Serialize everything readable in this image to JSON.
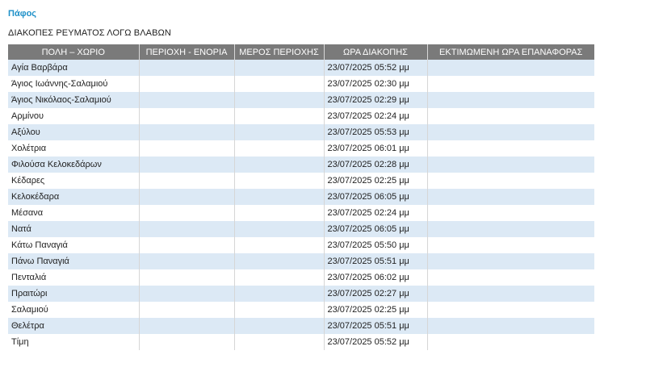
{
  "region": "Πάφος",
  "heading": "ΔΙΑΚΟΠΕΣ ΡΕΥΜΑΤΟΣ ΛΟΓΩ ΒΛΑΒΩΝ",
  "columns": [
    "ΠΟΛΗ – ΧΩΡΙΟ",
    "ΠΕΡΙΟΧΗ - ΕΝΟΡΙΑ",
    "ΜΕΡΟΣ ΠΕΡΙΟΧΗΣ",
    "ΩΡΑ ΔΙΑΚΟΠΗΣ",
    "ΕΚΤΙΜΩΜΕΝΗ ΩΡΑ ΕΠΑΝΑΦΟΡΑΣ"
  ],
  "rows": [
    {
      "village": "Αγία Βαρβάρα",
      "area": "",
      "part": "",
      "outage_time": "23/07/2025 05:52 μμ",
      "restore_time": ""
    },
    {
      "village": "Άγιος Ιωάννης-Σαλαμιού",
      "area": "",
      "part": "",
      "outage_time": "23/07/2025 02:30 μμ",
      "restore_time": ""
    },
    {
      "village": "Άγιος Νικόλαος-Σαλαμιού",
      "area": "",
      "part": "",
      "outage_time": "23/07/2025 02:29 μμ",
      "restore_time": ""
    },
    {
      "village": "Αρμίνου",
      "area": "",
      "part": "",
      "outage_time": "23/07/2025 02:24 μμ",
      "restore_time": ""
    },
    {
      "village": "Αξύλου",
      "area": "",
      "part": "",
      "outage_time": "23/07/2025 05:53 μμ",
      "restore_time": ""
    },
    {
      "village": "Χολέτρια",
      "area": "",
      "part": "",
      "outage_time": "23/07/2025 06:01 μμ",
      "restore_time": ""
    },
    {
      "village": "Φιλούσα Κελοκεδάρων",
      "area": "",
      "part": "",
      "outage_time": "23/07/2025 02:28 μμ",
      "restore_time": ""
    },
    {
      "village": "Κέδαρες",
      "area": "",
      "part": "",
      "outage_time": "23/07/2025 02:25 μμ",
      "restore_time": ""
    },
    {
      "village": "Κελοκέδαρα",
      "area": "",
      "part": "",
      "outage_time": "23/07/2025 06:05 μμ",
      "restore_time": ""
    },
    {
      "village": "Μέσανα",
      "area": "",
      "part": "",
      "outage_time": "23/07/2025 02:24 μμ",
      "restore_time": ""
    },
    {
      "village": "Νατά",
      "area": "",
      "part": "",
      "outage_time": "23/07/2025 06:05 μμ",
      "restore_time": ""
    },
    {
      "village": "Κάτω Παναγιά",
      "area": "",
      "part": "",
      "outage_time": "23/07/2025 05:50 μμ",
      "restore_time": ""
    },
    {
      "village": "Πάνω Παναγιά",
      "area": "",
      "part": "",
      "outage_time": "23/07/2025 05:51 μμ",
      "restore_time": ""
    },
    {
      "village": "Πενταλιά",
      "area": "",
      "part": "",
      "outage_time": "23/07/2025 06:02 μμ",
      "restore_time": ""
    },
    {
      "village": "Πραιτώρι",
      "area": "",
      "part": "",
      "outage_time": "23/07/2025 02:27 μμ",
      "restore_time": ""
    },
    {
      "village": "Σαλαμιού",
      "area": "",
      "part": "",
      "outage_time": "23/07/2025 02:25 μμ",
      "restore_time": ""
    },
    {
      "village": "Θελέτρα",
      "area": "",
      "part": "",
      "outage_time": "23/07/2025 05:51 μμ",
      "restore_time": ""
    },
    {
      "village": "Τίμη",
      "area": "",
      "part": "",
      "outage_time": "23/07/2025 05:52 μμ",
      "restore_time": ""
    }
  ]
}
